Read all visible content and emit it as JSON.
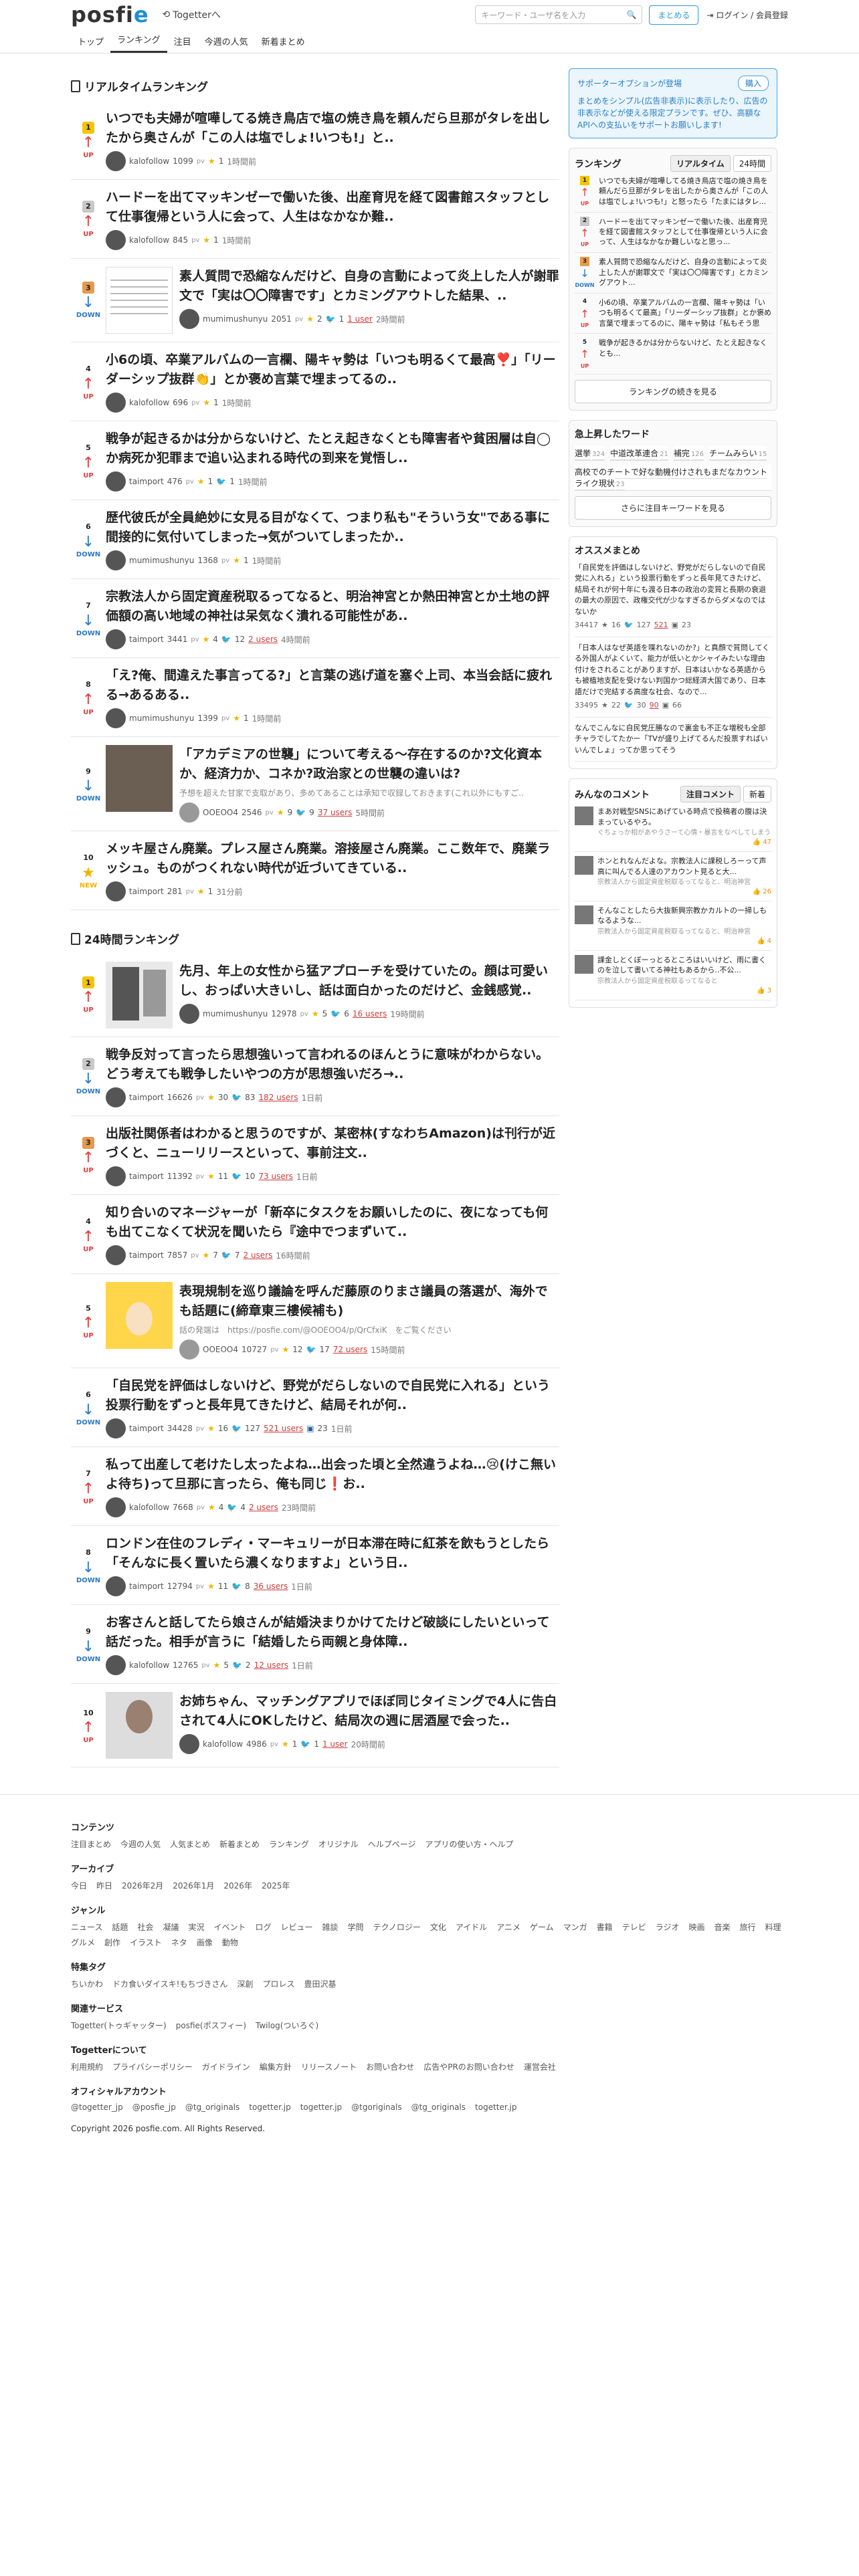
{
  "header": {
    "logo_main": "posfi",
    "logo_e": "e",
    "togetter_link": "Togetterへ",
    "search_placeholder": "キーワード・ユーザ名を入力",
    "create_label": "まとめる",
    "login_label": "ログイン / 会員登録"
  },
  "nav": {
    "tabs": [
      "トップ",
      "ランキング",
      "注目",
      "今週の人気",
      "新着まとめ"
    ],
    "active": 1
  },
  "realtime": {
    "title": "リアルタイムランキング",
    "items": [
      {
        "rank": "1",
        "trend": "UP",
        "title": "いつでも夫婦が喧嘩してる焼き鳥店で塩の焼き鳥を頼んだら旦那がタレを出したから奥さんが「この人は塩でしょ!いつも!」と..",
        "user": "kalofollow",
        "pv": "1099",
        "stars": "1",
        "time": "1時間前",
        "thumb": "none"
      },
      {
        "rank": "2",
        "trend": "UP",
        "title": "ハードーを出てマッキンゼーで働いた後、出産育児を経て図書館スタッフとして仕事復帰という人に会って、人生はなかなか難..",
        "user": "kalofollow",
        "pv": "845",
        "stars": "1",
        "time": "1時間前",
        "thumb": "none"
      },
      {
        "rank": "3",
        "trend": "DOWN",
        "title": "素人質問で恐縮なんだけど、自身の言動によって炎上した人が謝罪文で「実は〇〇障害です」とカミングアウトした結果、..",
        "user": "mumimushunyu",
        "pv": "2051",
        "stars": "2",
        "tw": "1",
        "users": "1 user",
        "time": "2時間前",
        "thumb": "doc"
      },
      {
        "rank": "4",
        "trend": "UP",
        "title": "小6の頃、卒業アルバムの一言欄、陽キャ勢は「いつも明るくて最高❣️」「リーダーシップ抜群👏」とか褒め言葉で埋まってるの..",
        "user": "kalofollow",
        "pv": "696",
        "stars": "1",
        "time": "1時間前",
        "thumb": "none"
      },
      {
        "rank": "5",
        "trend": "UP",
        "title": "戦争が起きるかは分からないけど、たとえ起きなくとも障害者や貧困層は自◯か病死か犯罪まで追い込まれる時代の到来を覚悟し..",
        "user": "taimport",
        "pv": "476",
        "stars": "1",
        "tw": "1",
        "time": "1時間前",
        "thumb": "none"
      },
      {
        "rank": "6",
        "trend": "DOWN",
        "title": "歴代彼氏が全員絶妙に女見る目がなくて、つまり私も\"そういう女\"である事に間接的に気付いてしまった→気がついてしまったか..",
        "user": "mumimushunyu",
        "pv": "1368",
        "stars": "1",
        "time": "1時間前",
        "thumb": "none"
      },
      {
        "rank": "7",
        "trend": "DOWN",
        "title": "宗教法人から固定資産税取るってなると、明治神宮とか熱田神宮とか土地の評価額の高い地域の神社は呆気なく潰れる可能性があ..",
        "user": "taimport",
        "pv": "3441",
        "stars": "4",
        "tw": "12",
        "users": "2 users",
        "time": "4時間前",
        "thumb": "none"
      },
      {
        "rank": "8",
        "trend": "UP",
        "title": "「え?俺、間違えた事言ってる?」と言葉の逃げ道を塞ぐ上司、本当会話に疲れる→あるある..",
        "user": "mumimushunyu",
        "pv": "1399",
        "stars": "1",
        "time": "1時間前",
        "thumb": "none"
      },
      {
        "rank": "9",
        "trend": "DOWN",
        "title": "「アカデミアの世襲」について考える〜存在するのか?文化資本か、経済力か、コネか?政治家との世襲の違いは?",
        "desc": "予想を超えた甘家で支取があり、多めてあることは承知で収録しておきます(これ以外にもすご..",
        "user": "OOEOO4",
        "pv": "2546",
        "stars": "9",
        "tw": "9",
        "users": "37 users",
        "time": "5時間前",
        "thumb": "photo"
      },
      {
        "rank": "10",
        "trend": "NEW",
        "title": "メッキ屋さん廃業。プレス屋さん廃業。溶接屋さん廃業。ここ数年で、廃業ラッシュ。ものがつくれない時代が近づいてきている..",
        "user": "taimport",
        "pv": "281",
        "stars": "1",
        "time": "31分前",
        "thumb": "none"
      }
    ]
  },
  "daily": {
    "title": "24時間ランキング",
    "items": [
      {
        "rank": "1",
        "trend": "UP",
        "title": "先月、年上の女性から猛アプローチを受けていたの。顔は可愛いし、おっぱい大きいし、話は面白かったのだけど、金銭感覚..",
        "user": "mumimushunyu",
        "pv": "12978",
        "stars": "5",
        "tw": "6",
        "users": "16 users",
        "time": "19時間前",
        "thumb": "comic"
      },
      {
        "rank": "2",
        "trend": "DOWN",
        "title": "戦争反対って言ったら思想強いって言われるのほんとうに意味がわからない。どう考えても戦争したいやつの方が思想強いだろ→..",
        "user": "taimport",
        "pv": "16626",
        "stars": "30",
        "tw": "83",
        "users": "182 users",
        "time": "1日前",
        "thumb": "none"
      },
      {
        "rank": "3",
        "trend": "UP",
        "title": "出版社関係者はわかると思うのですが、某密林(すなわちAmazon)は刊行が近づくと、ニューリリースといって、事前注文..",
        "user": "taimport",
        "pv": "11392",
        "stars": "11",
        "tw": "10",
        "users": "73 users",
        "time": "1日前",
        "thumb": "none"
      },
      {
        "rank": "4",
        "trend": "UP",
        "title": "知り合いのマネージャーが「新卒にタスクをお願いしたのに、夜になっても何も出てこなくて状況を聞いたら『途中でつまずいて..",
        "user": "taimport",
        "pv": "7857",
        "stars": "7",
        "tw": "7",
        "users": "2 users",
        "time": "16時間前",
        "thumb": "none"
      },
      {
        "rank": "5",
        "trend": "UP",
        "title": "表現規制を巡り議論を呼んだ藤原のりまさ議員の落選が、海外でも話題に(締章東三樓候補も)",
        "desc": "話の発端は　https://posfie.com/@OOEOO4/p/QrCfxiK　をご覧ください",
        "user": "OOEOO4",
        "pv": "10727",
        "stars": "12",
        "tw": "17",
        "users": "72 users",
        "time": "15時間前",
        "thumb": "yellow"
      },
      {
        "rank": "6",
        "trend": "DOWN",
        "title": "「自民党を評価はしないけど、野党がだらしないので自民党に入れる」という投票行動をずっと長年見てきたけど、結局それが何..",
        "user": "taimport",
        "pv": "34428",
        "stars": "16",
        "tw": "127",
        "users": "521 users",
        "cm": "23",
        "time": "1日前",
        "thumb": "none"
      },
      {
        "rank": "7",
        "trend": "UP",
        "title": "私って出産して老けたし太ったよね…出会った頃と全然違うよね…😢(けこ無いよ待ち)って旦那に言ったら、俺も同じ❗️お..",
        "user": "kalofollow",
        "pv": "7668",
        "stars": "4",
        "tw": "4",
        "users": "2 users",
        "time": "23時間前",
        "thumb": "none"
      },
      {
        "rank": "8",
        "trend": "DOWN",
        "title": "ロンドン在住のフレディ・マーキュリーが日本滞在時に紅茶を飲もうとしたら「そんなに長く置いたら濃くなりますよ」という日..",
        "user": "taimport",
        "pv": "12794",
        "stars": "11",
        "tw": "8",
        "users": "36 users",
        "time": "1日前",
        "thumb": "none"
      },
      {
        "rank": "9",
        "trend": "DOWN",
        "title": "お客さんと話してたら娘さんが結婚決まりかけてたけど破談にしたいといって話だった。相手が言うに「結婚したら両親と身体障..",
        "user": "kalofollow",
        "pv": "12765",
        "stars": "5",
        "tw": "2",
        "users": "12 users",
        "time": "1日前",
        "thumb": "none"
      },
      {
        "rank": "10",
        "trend": "UP",
        "title": "お姉ちゃん、マッチングアプリでほぼ同じタイミングで4人に告白されて4人にOKしたけど、結局次の週に居酒屋で会った..",
        "user": "kalofollow",
        "pv": "4986",
        "stars": "1",
        "tw": "1",
        "users": "1 user",
        "time": "20時間前",
        "thumb": "portrait"
      }
    ]
  },
  "sidebar": {
    "banner": {
      "title": "サポーターオプションが登場",
      "buy": "購入",
      "text": "まとめをシンプル(広告非表示)に表示したり、広告の非表示などが使える限定プランです。ぜひ、高額なAPIへの支払いをサポートお願いします!"
    },
    "ranking": {
      "title": "ランキング",
      "seg": [
        "リアルタイム",
        "24時間"
      ],
      "items": [
        {
          "rank": "1",
          "trend": "UP",
          "text": "いつでも夫婦が喧嘩してる焼き鳥店で塩の焼き鳥を頼んだら旦那がタレを出したから奥さんが「この人は塩でしょ!いつも!」と怒ったら「たまにはタレ..."
        },
        {
          "rank": "2",
          "trend": "UP",
          "text": "ハードーを出てマッキンゼーで働いた後、出産育児を経て図書館スタッフとして仕事復帰という人に会って、人生はなかなか難しいなと思っ..."
        },
        {
          "rank": "3",
          "trend": "DOWN",
          "text": "素人質問で恐縮なんだけど、自身の言動によって炎上した人が謝罪文で「実は〇〇障害です」とカミングアウト..."
        },
        {
          "rank": "4",
          "trend": "UP",
          "text": "小6の頃、卒業アルバムの一言欄、陽キャ勢は「いつも明るくて最高」「リーダーシップ抜群」とか褒め言葉で埋まってるのに、陽キャ勢は「私もそう思う..."
        },
        {
          "rank": "5",
          "trend": "UP",
          "text": "戦争が起きるかは分からないけど、たとえ起きなくとも..."
        }
      ],
      "more": "ランキングの続きを見る"
    },
    "keywords": {
      "title": "急上昇したワード",
      "items": [
        {
          "w": "選挙",
          "c": "324"
        },
        {
          "w": "中道改革連合",
          "c": "21"
        },
        {
          "w": "補完",
          "c": "126"
        },
        {
          "w": "チームみらい",
          "c": "15"
        },
        {
          "w": "高校でのチートで好な動機付けされもまだなカウントライク現状",
          "c": "23"
        }
      ],
      "more": "さらに注目キーワードを見る"
    },
    "recommend": {
      "title": "オススメまとめ",
      "items": [
        {
          "text": "「自民党を評価はしないけど、野党がだらしないので自民党に入れる」という投票行動をずっと長年見てきたけど、結局それが何十年にも渡る日本の政治の変質と長期の衰退の最大の原因で、政権交代が少なすぎるからダメなのではないか",
          "pv": "34417",
          "stars": "16",
          "tw": "127",
          "users": "521",
          "cm": "23"
        },
        {
          "text": "「日本人はなぜ英語を喋れないのか?」と真顔で質問してくる外国人がよくいて、能力が低いとかシャイみたいな理由付けをされることがありますが、日本はいかなる英語からも被植地支配を受けない判国かつ総経済大国であり、日本語だけで完結する高度な社会、なので...",
          "pv": "33495",
          "stars": "22",
          "tw": "30",
          "users": "90",
          "cm": "66"
        },
        {
          "text": "なんでこんなに自民党圧勝なので裏金も不正な増税も全部チャラでしてたかー「TVが盛り上げてるんだ投票すればいいんでしょ」ってか思ってそう",
          "pv": "",
          "stars": "",
          "tw": "",
          "users": "",
          "cm": ""
        }
      ]
    },
    "comments": {
      "title": "みんなのコメント",
      "seg": [
        "注目コメント",
        "新着"
      ],
      "items": [
        {
          "text": "まあ対戦型SNSにあげている時点で投稿者の腹は決まっているやろ。",
          "src": "ぐちょっか相があやうさーて心情・暴言をなべしてしまう",
          "likes": "47"
        },
        {
          "text": "ホンとれなんだよな。宗教法人に課税しろーって声高に叫んでる人達のアカウント見ると大...",
          "src": "宗教法人から固定資産税取るってなると、明治神宮",
          "likes": "26"
        },
        {
          "text": "そんなことしたら大抜新興宗教かカルトの一掃しもなるような...",
          "src": "宗教法人から固定資産税取るってなると、明治神宮",
          "likes": "4"
        },
        {
          "text": "課金しとくぼーっとるところはいいけど、雨に書くのを泣して書いてる神社もあるから..不公...",
          "src": "宗教法人から固定資産税取るってなると",
          "likes": "3"
        }
      ]
    }
  },
  "footer": {
    "sections": [
      {
        "title": "コンテンツ",
        "links": [
          "注目まとめ",
          "今週の人気",
          "人気まとめ",
          "新着まとめ",
          "ランキング",
          "オリジナル",
          "ヘルプページ",
          "アプリの使い方・ヘルプ"
        ]
      },
      {
        "title": "アーカイブ",
        "links": [
          "今日",
          "昨日",
          "2026年2月",
          "2026年1月",
          "2026年",
          "2025年"
        ]
      },
      {
        "title": "ジャンル",
        "links": [
          "ニュース",
          "話題",
          "社会",
          "凝議",
          "実況",
          "イベント",
          "ログ",
          "レビュー",
          "雑談",
          "学問",
          "テクノロジー",
          "文化",
          "アイドル",
          "アニメ",
          "ゲーム",
          "マンガ",
          "書籍",
          "テレビ",
          "ラジオ",
          "映画",
          "音楽",
          "旅行",
          "料理",
          "グルメ",
          "創作",
          "イラスト",
          "ネタ",
          "画像",
          "動物"
        ]
      },
      {
        "title": "特集タグ",
        "links": [
          "ちいかわ",
          "ドカ食いダイスキ!もちづきさん",
          "深創",
          "プロレス",
          "豊田沢基"
        ]
      },
      {
        "title": "関連サービス",
        "links": [
          "Togetter(トゥギャッター)",
          "posfie(ポスフィー)",
          "Twilog(ついろぐ)"
        ]
      },
      {
        "title": "Togetterについて",
        "links": [
          "利用規約",
          "プライバシーポリシー",
          "ガイドライン",
          "編集方針",
          "リリースノート",
          "お問い合わせ",
          "広告やPRのお問い合わせ",
          "運営会社"
        ]
      },
      {
        "title": "オフィシャルアカウント",
        "links": [
          "@togetter_jp",
          "@posfie_jp",
          "@tg_originals",
          "togetter.jp",
          "togetter.jp",
          "@tgoriginals",
          "@tg_originals",
          "togetter.jp"
        ]
      }
    ],
    "copyright": "Copyright 2026 posfie.com. All Rights Reserved."
  }
}
